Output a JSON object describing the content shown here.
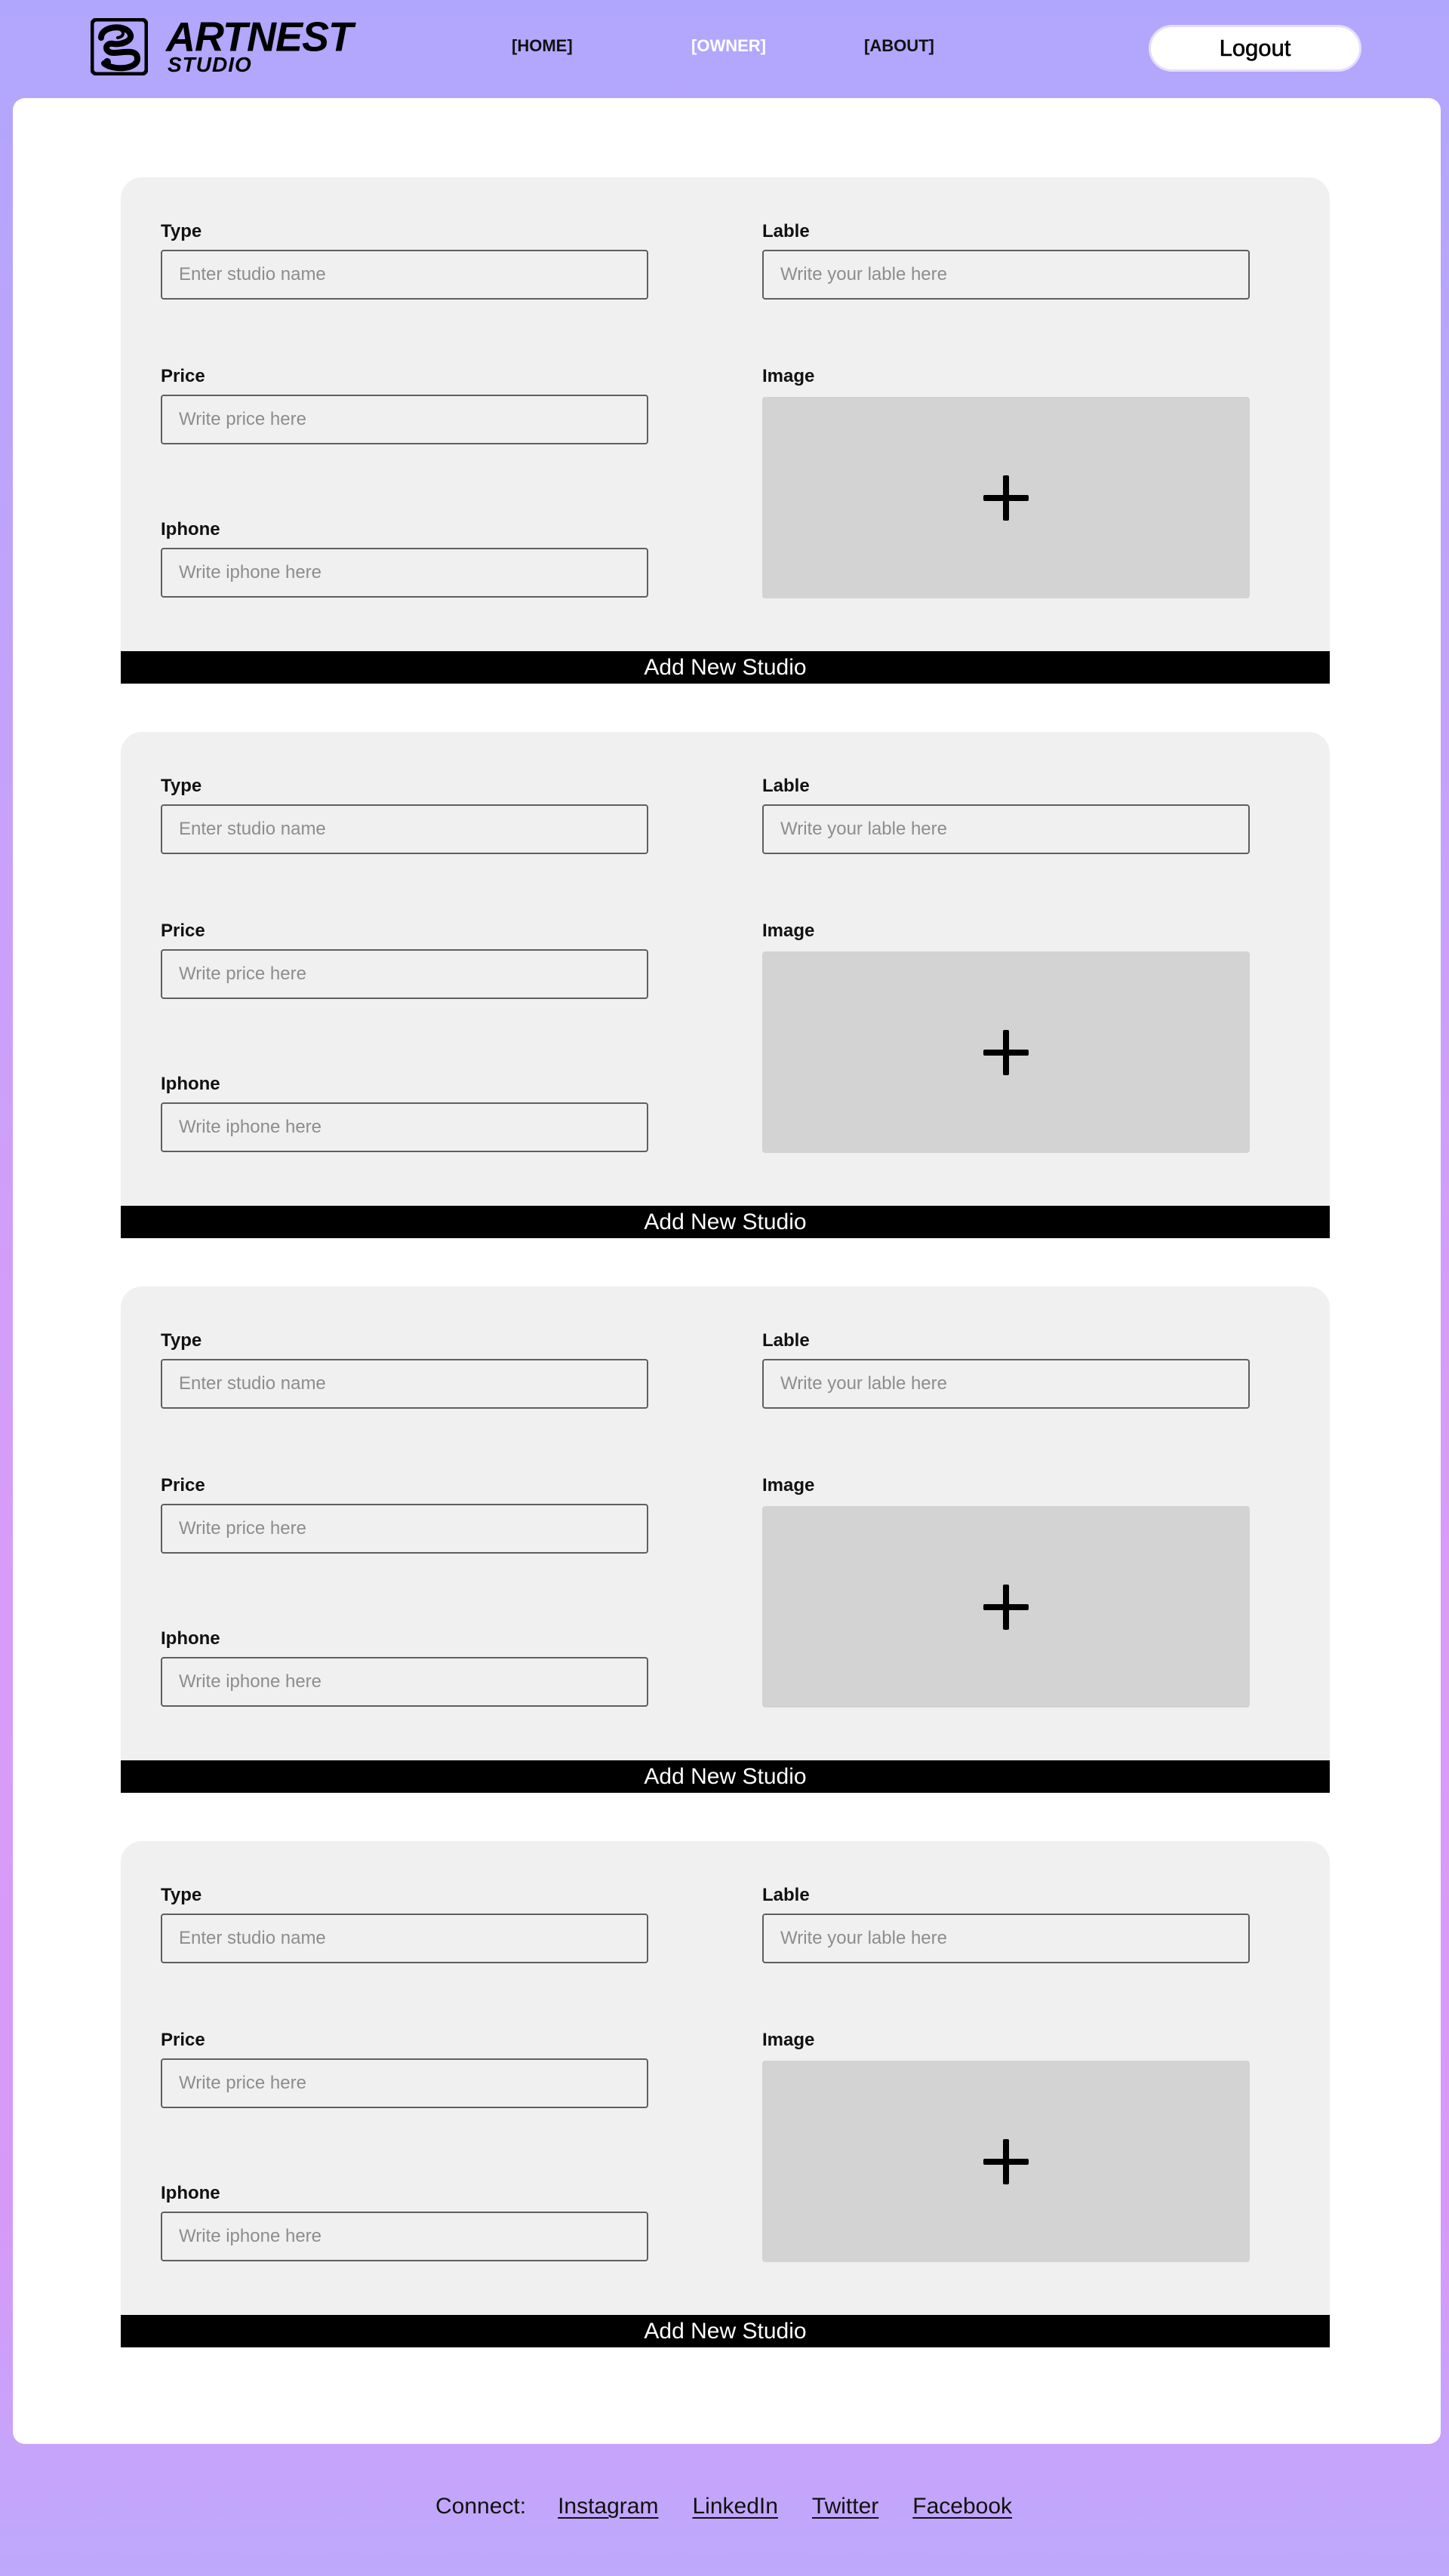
{
  "brand": {
    "title": "ARTNEST",
    "subtitle": "STUDIO"
  },
  "nav": {
    "home": "[HOME]",
    "owner": "[OWNER]",
    "about": "[ABOUT]",
    "active": "owner"
  },
  "header": {
    "logout_label": "Logout"
  },
  "forms": [
    {
      "type_label": "Type",
      "type_placeholder": "Enter studio name",
      "lable_label": "Lable",
      "lable_placeholder": "Write your lable here",
      "price_label": "Price",
      "price_placeholder": "Write price here",
      "image_label": "Image",
      "iphone_label": "Iphone",
      "iphone_placeholder": "Write iphone here",
      "submit_label": "Add New Studio"
    },
    {
      "type_label": "Type",
      "type_placeholder": "Enter studio name",
      "lable_label": "Lable",
      "lable_placeholder": "Write your lable here",
      "price_label": "Price",
      "price_placeholder": "Write price here",
      "image_label": "Image",
      "iphone_label": "Iphone",
      "iphone_placeholder": "Write iphone here",
      "submit_label": "Add New Studio"
    },
    {
      "type_label": "Type",
      "type_placeholder": "Enter studio name",
      "lable_label": "Lable",
      "lable_placeholder": "Write your lable here",
      "price_label": "Price",
      "price_placeholder": "Write price here",
      "image_label": "Image",
      "iphone_label": "Iphone",
      "iphone_placeholder": "Write iphone here",
      "submit_label": "Add New Studio"
    },
    {
      "type_label": "Type",
      "type_placeholder": "Enter studio name",
      "lable_label": "Lable",
      "lable_placeholder": "Write your lable here",
      "price_label": "Price",
      "price_placeholder": "Write price here",
      "image_label": "Image",
      "iphone_label": "Iphone",
      "iphone_placeholder": "Write iphone here",
      "submit_label": "Add New Studio"
    }
  ],
  "icons": {
    "logo": "artnest-logo-mark",
    "image_upload": "plus-icon"
  },
  "footer": {
    "label": "Connect:",
    "links": [
      "Instagram",
      "LinkedIn",
      "Twitter",
      "Facebook"
    ]
  },
  "colors": {
    "card_background": "#f0f0f0",
    "image_dropzone": "#d3d3d3",
    "submit_button": "#000000",
    "active_nav": "#ffffff"
  }
}
